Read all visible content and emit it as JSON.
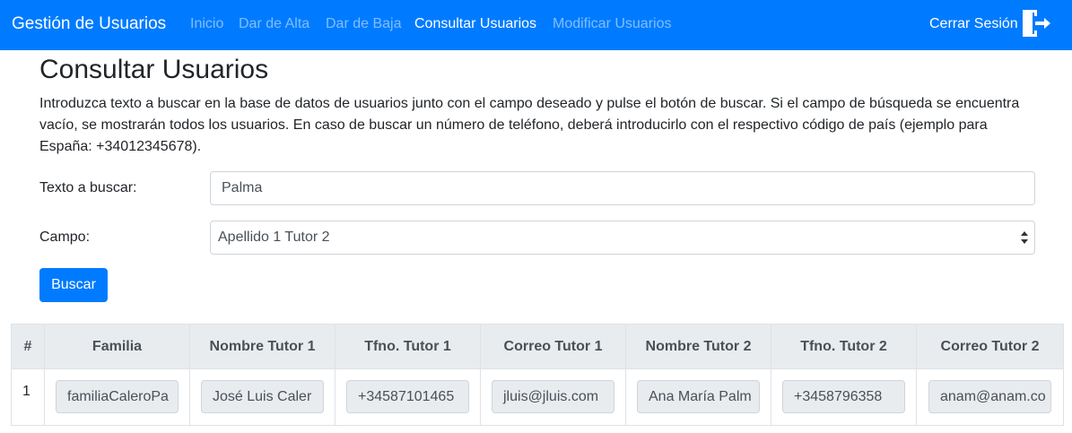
{
  "navbar": {
    "brand": "Gestión de Usuarios",
    "links": [
      {
        "label": "Inicio",
        "active": false
      },
      {
        "label": "Dar de Alta",
        "active": false
      },
      {
        "label": "Dar de Baja",
        "active": false
      },
      {
        "label": "Consultar Usuarios",
        "active": true
      },
      {
        "label": "Modificar Usuarios",
        "active": false
      }
    ],
    "logout_label": "Cerrar Sesión",
    "logout_icon": "logout-door-icon",
    "background_color": "#007bff"
  },
  "main": {
    "title": "Consultar Usuarios",
    "intro": "Introduzca texto a buscar en la base de datos de usuarios junto con el campo deseado y pulse el botón de buscar. Si el campo de búsqueda se encuentra vacío, se mostrarán todos los usuarios. En caso de buscar un número de teléfono, deberá introducirlo con el respectivo código de país (ejemplo para España: +34012345678).",
    "search_label": "Texto a buscar:",
    "search_value": "Palma",
    "field_label": "Campo:",
    "field_selected": "Apellido 1 Tutor 2",
    "search_button": "Buscar"
  },
  "table": {
    "headers": [
      "#",
      "Familia",
      "Nombre Tutor 1",
      "Tfno. Tutor 1",
      "Correo Tutor 1",
      "Nombre Tutor 2",
      "Tfno. Tutor 2",
      "Correo Tutor 2"
    ],
    "rows": [
      {
        "index": "1",
        "cells": [
          "familiaCaleroPa",
          "José Luis Caler",
          "+34587101465",
          "jluis@jluis.com",
          "Ana María Palm",
          "+3458796358",
          "anam@anam.co"
        ]
      }
    ]
  }
}
